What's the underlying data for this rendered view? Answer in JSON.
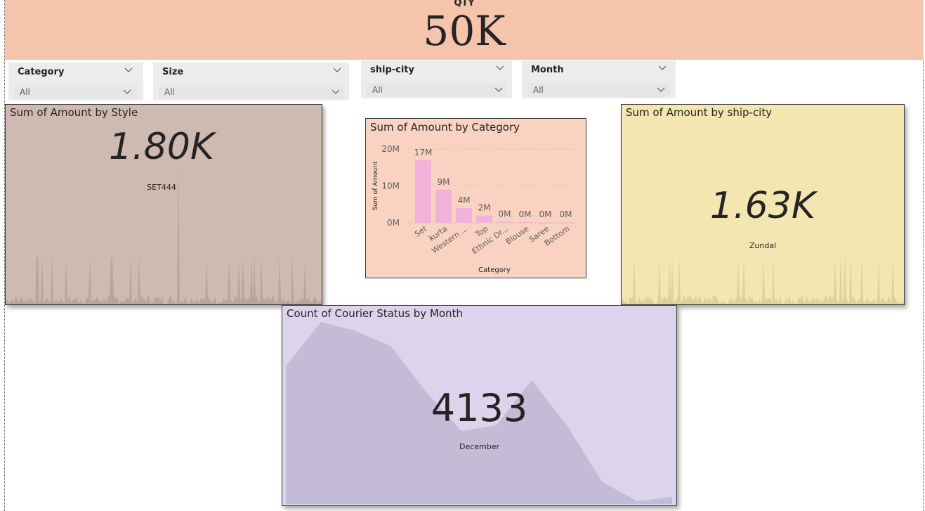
{
  "kpi": {
    "label": "QTY",
    "value": "50K"
  },
  "slicers": [
    {
      "title": "Category",
      "value": "All"
    },
    {
      "title": "Size",
      "value": "All"
    },
    {
      "title": "ship-city",
      "value": "All"
    },
    {
      "title": "Month",
      "value": "All"
    }
  ],
  "cards": {
    "style": {
      "title": "Sum of Amount by Style",
      "value": "1.80K",
      "label": "SET444",
      "background": "#cfbab2",
      "spark_color": "#b5a39b"
    },
    "city": {
      "title": "Sum of Amount by ship-city",
      "value": "1.63K",
      "label": "Zundal",
      "background": "#f3e6b1",
      "spark_color": "#dccf99"
    },
    "courier": {
      "title": "Count of Courier Status by Month",
      "value": "4133",
      "label": "December",
      "background": "#dcd3ec",
      "area_color": "#c4bcd6"
    }
  },
  "chart_data": {
    "type": "bar",
    "title": "Sum of Amount by Category",
    "xlabel": "Category",
    "ylabel": "Sum of Amount",
    "categories": [
      "Set",
      "kurta",
      "Western ...",
      "Top",
      "Ethnic Dr...",
      "Blouse",
      "Saree",
      "Bottom"
    ],
    "values": [
      17,
      9,
      4,
      2,
      0.3,
      0.2,
      0.05,
      0.05
    ],
    "data_labels": [
      "17M",
      "9M",
      "4M",
      "2M",
      "0M",
      "0M",
      "0M",
      "0M"
    ],
    "yticks": [
      "20M",
      "10M",
      "0M"
    ],
    "ylim": [
      0,
      20
    ],
    "bar_color": "#f0b2d8"
  }
}
